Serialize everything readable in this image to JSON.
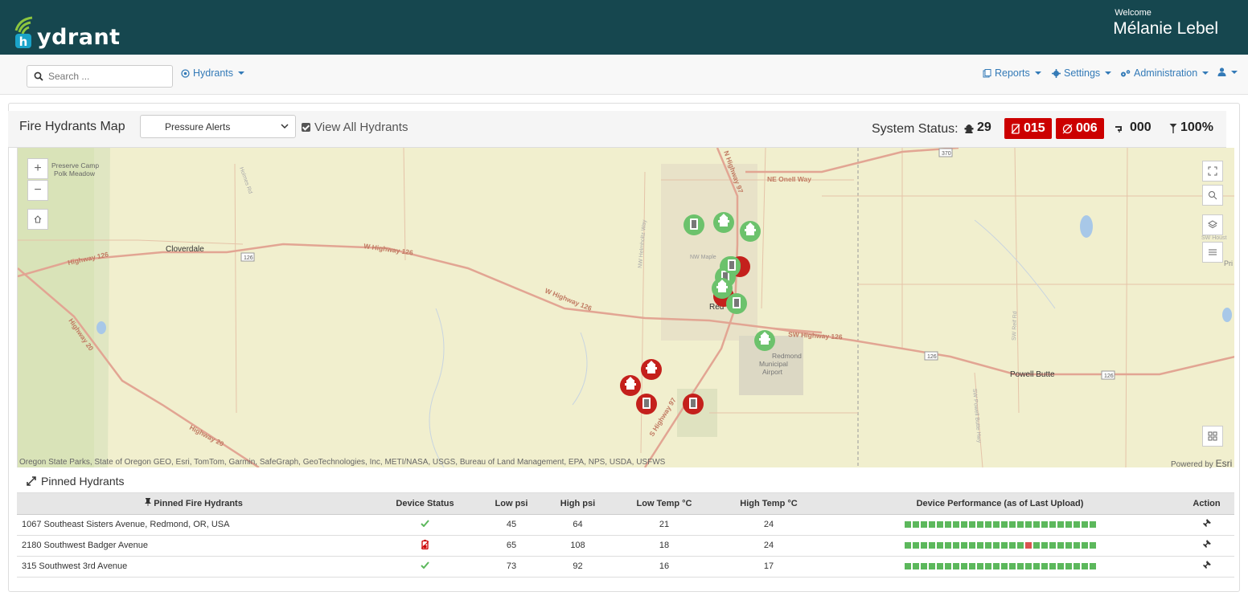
{
  "app": {
    "logo_text": "ydrant"
  },
  "user": {
    "welcome": "Welcome",
    "name": "Mélanie Lebel"
  },
  "nav": {
    "search_placeholder": "Search ...",
    "hydrants": "Hydrants",
    "reports": "Reports",
    "settings": "Settings",
    "administration": "Administration"
  },
  "map_panel": {
    "title": "Fire Hydrants Map",
    "filter_selected": "Pressure Alerts",
    "view_all_label": "View All Hydrants",
    "view_all_checked": true,
    "system_status_label": "System Status:",
    "status": {
      "hydrants": "29",
      "alerts_a": "015",
      "alerts_b": "006",
      "leaks": "000",
      "signal": "100%"
    }
  },
  "map": {
    "labels": {
      "preserve": "Preserve Camp",
      "polk": "Polk Meadow",
      "cloverdale": "Cloverdale",
      "highway126_w": "Highway 126",
      "w_highway126": "W Highway 126",
      "w_highway126_b": "W Highway 126",
      "sw_highway126": "SW Highway 126",
      "highway20": "Highway 20",
      "highway20_b": "Highway 20",
      "n_highway97": "N Highway 97",
      "s_highway97": "S Highway 97",
      "ne_onell": "NE Onell Way",
      "nw_maple": "NW Maple",
      "redmond": "Red",
      "airport1": "Redmond",
      "airport2": "Municipal",
      "airport3": "Airport",
      "powell": "Powell Butte",
      "shield_126_a": "126",
      "shield_126_b": "126",
      "shield_126_c": "126",
      "shield_370": "370",
      "holmes": "Holmes Rd",
      "helmholtz": "NW Helmholtz Way",
      "reif": "SW Reif Rd",
      "powell_hwy": "SW Powell Butte Hwy",
      "sw_houst": "SW Houst",
      "pri": "Pri"
    },
    "attribution": "Oregon State Parks, State of Oregon GEO, Esri, TomTom, Garmin, SafeGraph, GeoTechnologies, Inc, METI/NASA, USGS, Bureau of Land Management, EPA, NPS, USDA, USFWS",
    "powered_by": "Powered by",
    "esri": "Esri"
  },
  "pinned": {
    "title": "Pinned Hydrants",
    "columns": [
      "Pinned Fire Hydrants",
      "Device Status",
      "Low psi",
      "High psi",
      "Low Temp °C",
      "High Temp °C",
      "Device Performance (as of Last Upload)",
      "Action"
    ],
    "rows": [
      {
        "address": "1067 Southeast Sisters Avenue, Redmond, OR, USA",
        "status": "ok",
        "low_psi": "45",
        "high_psi": "64",
        "low_temp": "21",
        "high_temp": "24",
        "perf": "gggggggggggggggggggggggg"
      },
      {
        "address": "2180 Southwest Badger Avenue",
        "status": "battery",
        "low_psi": "65",
        "high_psi": "108",
        "low_temp": "18",
        "high_temp": "24",
        "perf": "gggggggggggggggrgggggggg"
      },
      {
        "address": "315 Southwest 3rd Avenue",
        "status": "ok",
        "low_psi": "73",
        "high_psi": "92",
        "low_temp": "16",
        "high_temp": "17",
        "perf": "gggggggggggggggggggggggg"
      }
    ]
  },
  "colors": {
    "header": "#16474f",
    "link": "#337ab7",
    "alert": "#cc0000",
    "ok": "#5cb85c",
    "marker_green": "#6cc26c",
    "marker_red": "#c4201c"
  }
}
